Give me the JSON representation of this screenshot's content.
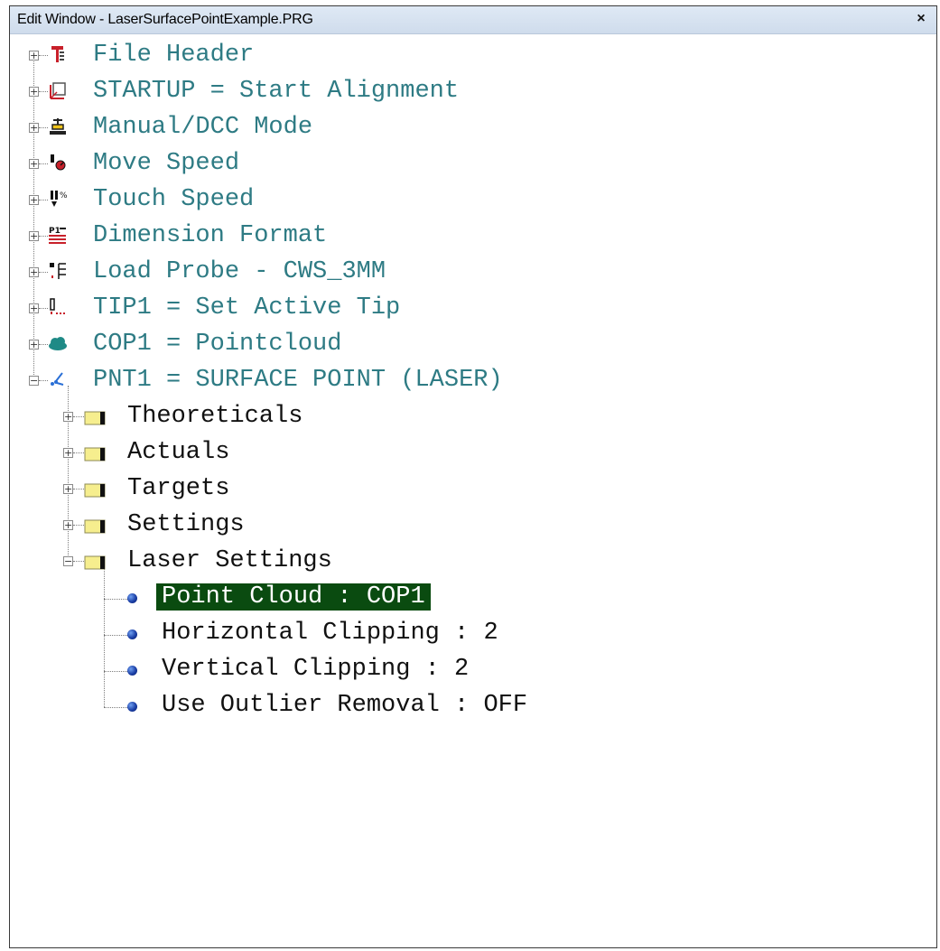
{
  "window": {
    "title": "Edit Window - LaserSurfacePointExample.PRG",
    "close_glyph": "×"
  },
  "tree": {
    "top_items": [
      {
        "label": "File Header",
        "icon": "file-header-icon"
      },
      {
        "label": "STARTUP = Start Alignment",
        "icon": "alignment-icon"
      },
      {
        "label": "Manual/DCC Mode",
        "icon": "cmm-mode-icon"
      },
      {
        "label": "Move Speed",
        "icon": "move-speed-icon"
      },
      {
        "label": "Touch Speed",
        "icon": "touch-speed-icon"
      },
      {
        "label": "Dimension Format",
        "icon": "dimension-format-icon"
      },
      {
        "label": "Load Probe - CWS_3MM",
        "icon": "load-probe-icon"
      },
      {
        "label": "TIP1 = Set Active Tip",
        "icon": "probe-tip-icon"
      },
      {
        "label": "COP1 = Pointcloud",
        "icon": "pointcloud-icon"
      },
      {
        "label": "PNT1 = SURFACE POINT (LASER)",
        "icon": "laser-point-icon"
      }
    ],
    "folders": [
      {
        "label": "Theoreticals",
        "expanded": false
      },
      {
        "label": "Actuals",
        "expanded": false
      },
      {
        "label": "Targets",
        "expanded": false
      },
      {
        "label": "Settings",
        "expanded": false
      },
      {
        "label": "Laser Settings",
        "expanded": true
      }
    ],
    "laser_settings": [
      {
        "label": "Point Cloud : COP1",
        "selected": true
      },
      {
        "label": "Horizontal Clipping : 2",
        "selected": false
      },
      {
        "label": "Vertical Clipping : 2",
        "selected": false
      },
      {
        "label": "Use Outlier Removal : OFF",
        "selected": false
      }
    ],
    "expand_glyph": "+",
    "collapse_glyph": "−"
  },
  "colors": {
    "text_teal": "#2e7b84",
    "selection_bg": "#0a4b10",
    "title_bar": "#d6e2f0"
  }
}
